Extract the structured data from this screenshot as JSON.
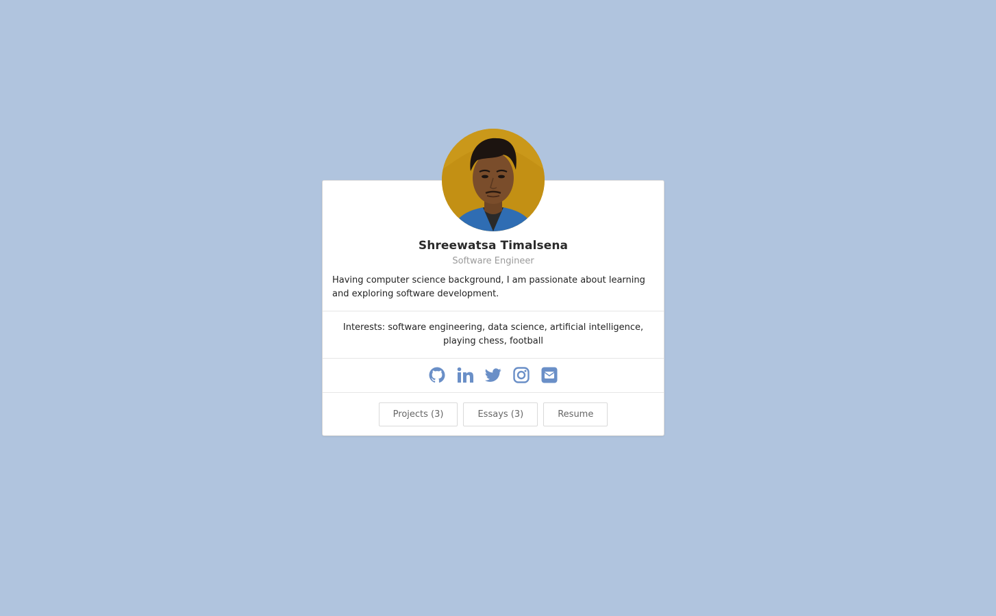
{
  "profile": {
    "name": "Shreewatsa Timalsena",
    "role": "Software Engineer",
    "bio": "Having computer science background, I am passionate about learning and exploring software development.",
    "interests": "Interests: software engineering, data science, artificial intelligence, playing chess, football"
  },
  "social": [
    {
      "icon": "github-icon"
    },
    {
      "icon": "linkedin-icon"
    },
    {
      "icon": "twitter-icon"
    },
    {
      "icon": "instagram-icon"
    },
    {
      "icon": "email-icon"
    }
  ],
  "buttons": {
    "projects": "Projects (3)",
    "essays": "Essays (3)",
    "resume": "Resume"
  },
  "colors": {
    "background": "#b0c4de",
    "icon": "#6a8fc7",
    "card": "#ffffff"
  }
}
